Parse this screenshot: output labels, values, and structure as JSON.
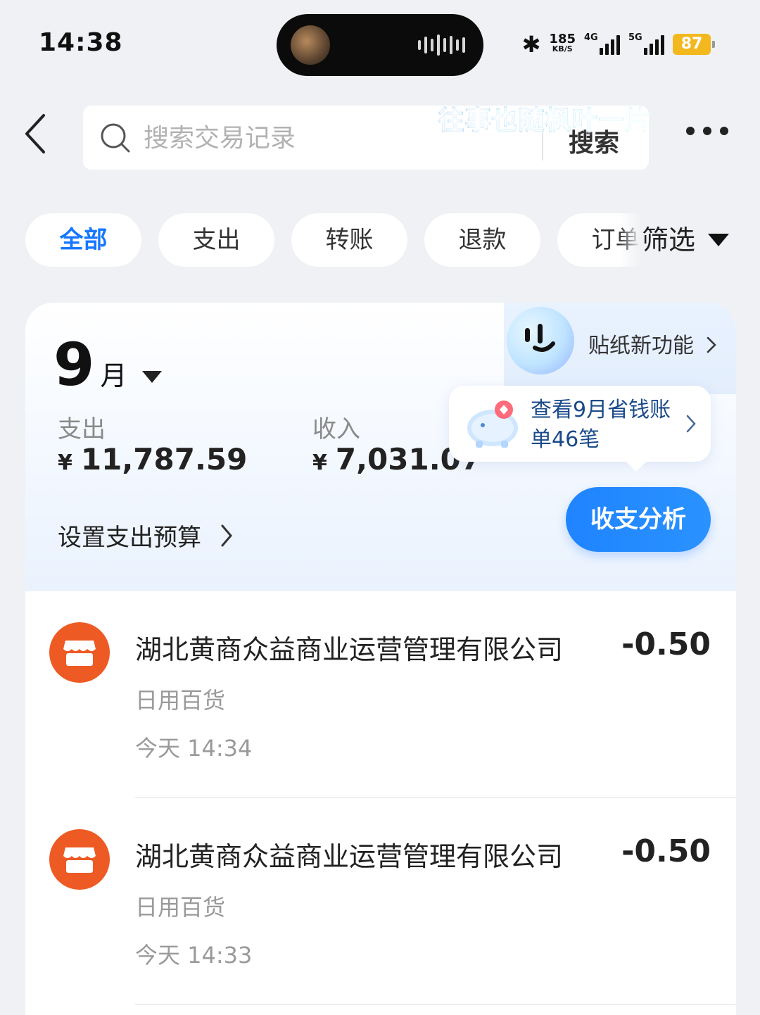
{
  "status_bar": {
    "time": "14:38",
    "net_speed": "185",
    "net_speed_unit": "KB/S",
    "sim1_type": "4G",
    "sim2_type": "5G",
    "battery": "87"
  },
  "header": {
    "search_placeholder": "搜索交易记录",
    "search_button": "搜索",
    "lyric_overlay": "往事也随枫叶一片"
  },
  "filter_tabs": [
    {
      "label": "全部",
      "active": true
    },
    {
      "label": "支出",
      "active": false
    },
    {
      "label": "转账",
      "active": false
    },
    {
      "label": "退款",
      "active": false
    },
    {
      "label": "订单",
      "active": false
    }
  ],
  "filter_button": "筛选",
  "summary": {
    "month_num": "9",
    "month_unit": "月",
    "sticker_label": "贴纸新功能",
    "expense_label": "支出",
    "expense_currency": "¥",
    "expense_amount": "11,787.59",
    "income_label": "收入",
    "income_currency": "¥",
    "income_amount": "7,031.07",
    "savings_tip": "查看9月省钱账单46笔",
    "budget_link": "设置支出预算",
    "analysis_button": "收支分析"
  },
  "transactions": [
    {
      "merchant": "湖北黄商众益商业运营管理有限公司",
      "amount": "-0.50",
      "category": "日用百货",
      "time": "今天 14:34"
    },
    {
      "merchant": "湖北黄商众益商业运营管理有限公司",
      "amount": "-0.50",
      "category": "日用百货",
      "time": "今天 14:33"
    }
  ],
  "colors": {
    "accent": "#1677ff",
    "merchant_icon": "#ee5a24",
    "battery": "#f3b81d",
    "background": "#eff1f4"
  }
}
